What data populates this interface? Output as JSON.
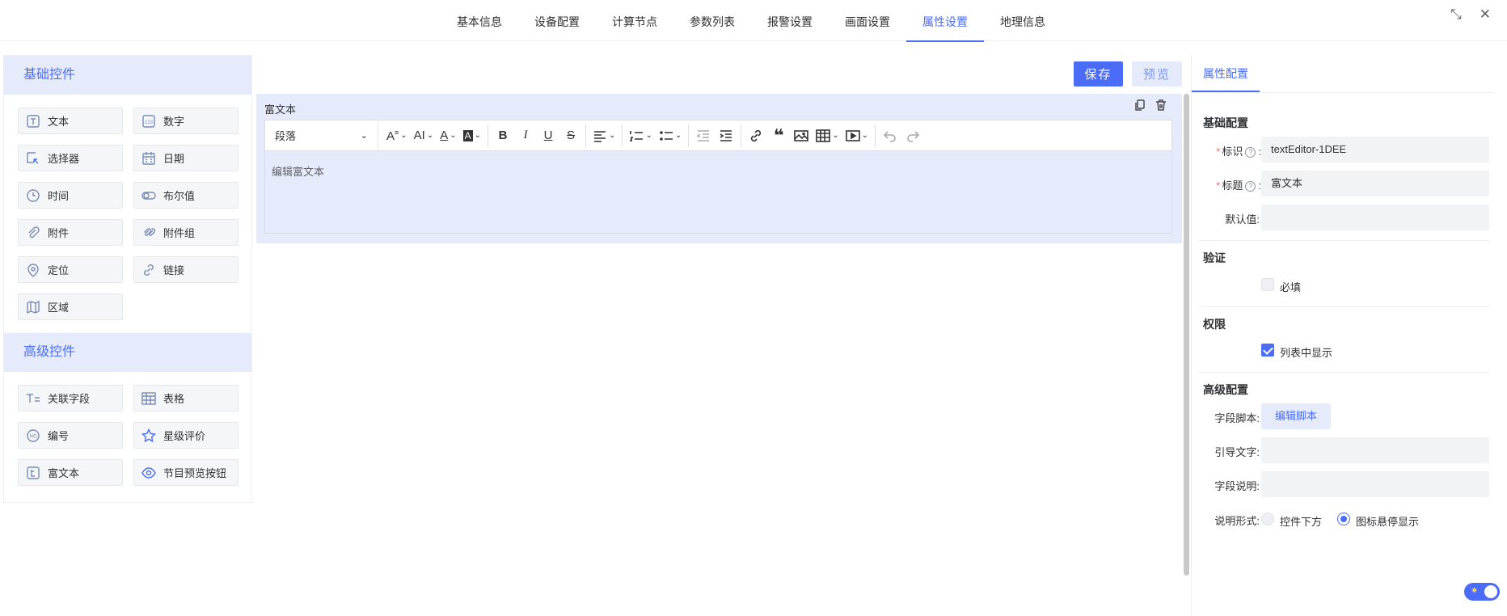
{
  "topnav": {
    "tabs": [
      {
        "label": "基本信息"
      },
      {
        "label": "设备配置"
      },
      {
        "label": "计算节点"
      },
      {
        "label": "参数列表"
      },
      {
        "label": "报警设置"
      },
      {
        "label": "画面设置"
      },
      {
        "label": "属性设置",
        "active": true
      },
      {
        "label": "地理信息"
      }
    ],
    "icons": [
      "compress-icon",
      "close-icon"
    ]
  },
  "left": {
    "basic_title": "基础控件",
    "basic_items": [
      {
        "label": "文本",
        "icon": "text-icon"
      },
      {
        "label": "数字",
        "icon": "number-icon"
      },
      {
        "label": "选择器",
        "icon": "select-icon"
      },
      {
        "label": "日期",
        "icon": "calendar-icon"
      },
      {
        "label": "时间",
        "icon": "clock-icon"
      },
      {
        "label": "布尔值",
        "icon": "toggle-icon"
      },
      {
        "label": "附件",
        "icon": "paperclip-icon"
      },
      {
        "label": "附件组",
        "icon": "paperclips-icon"
      },
      {
        "label": "定位",
        "icon": "location-icon"
      },
      {
        "label": "链接",
        "icon": "link-icon"
      },
      {
        "label": "区域",
        "icon": "map-icon"
      }
    ],
    "advanced_title": "高级控件",
    "advanced_items": [
      {
        "label": "关联字段",
        "icon": "relation-icon"
      },
      {
        "label": "表格",
        "icon": "table-icon"
      },
      {
        "label": "编号",
        "icon": "serial-icon"
      },
      {
        "label": "星级评价",
        "icon": "star-icon"
      },
      {
        "label": "富文本",
        "icon": "richtext-icon"
      },
      {
        "label": "节目预览按钮",
        "icon": "eye-icon"
      }
    ]
  },
  "center": {
    "save_label": "保存",
    "preview_label": "预览",
    "field_title": "富文本",
    "paragraph_label": "段落",
    "editor_placeholder": "编辑富文本"
  },
  "right": {
    "tab_label": "属性配置",
    "basic_section": "基础配置",
    "id_label": "标识",
    "id_value": "textEditor-1DEE",
    "title_label": "标题",
    "title_value": "富文本",
    "default_label": "默认值:",
    "default_value": "",
    "validation_section": "验证",
    "required_label": "必填",
    "required_checked": false,
    "permission_section": "权限",
    "show_in_list_label": "列表中显示",
    "show_in_list_checked": true,
    "advanced_section": "高级配置",
    "script_label": "字段脚本:",
    "script_button": "编辑脚本",
    "guide_label": "引导文字:",
    "guide_value": "",
    "desc_label": "字段说明:",
    "desc_value": "",
    "desc_form_label": "说明形式:",
    "desc_form_options": [
      "控件下方",
      "图标悬停显示"
    ],
    "desc_form_selected": "图标悬停显示",
    "colon": ":"
  },
  "colors": {
    "accent": "#4a6cf7",
    "accent_light": "#e6ebfb"
  }
}
